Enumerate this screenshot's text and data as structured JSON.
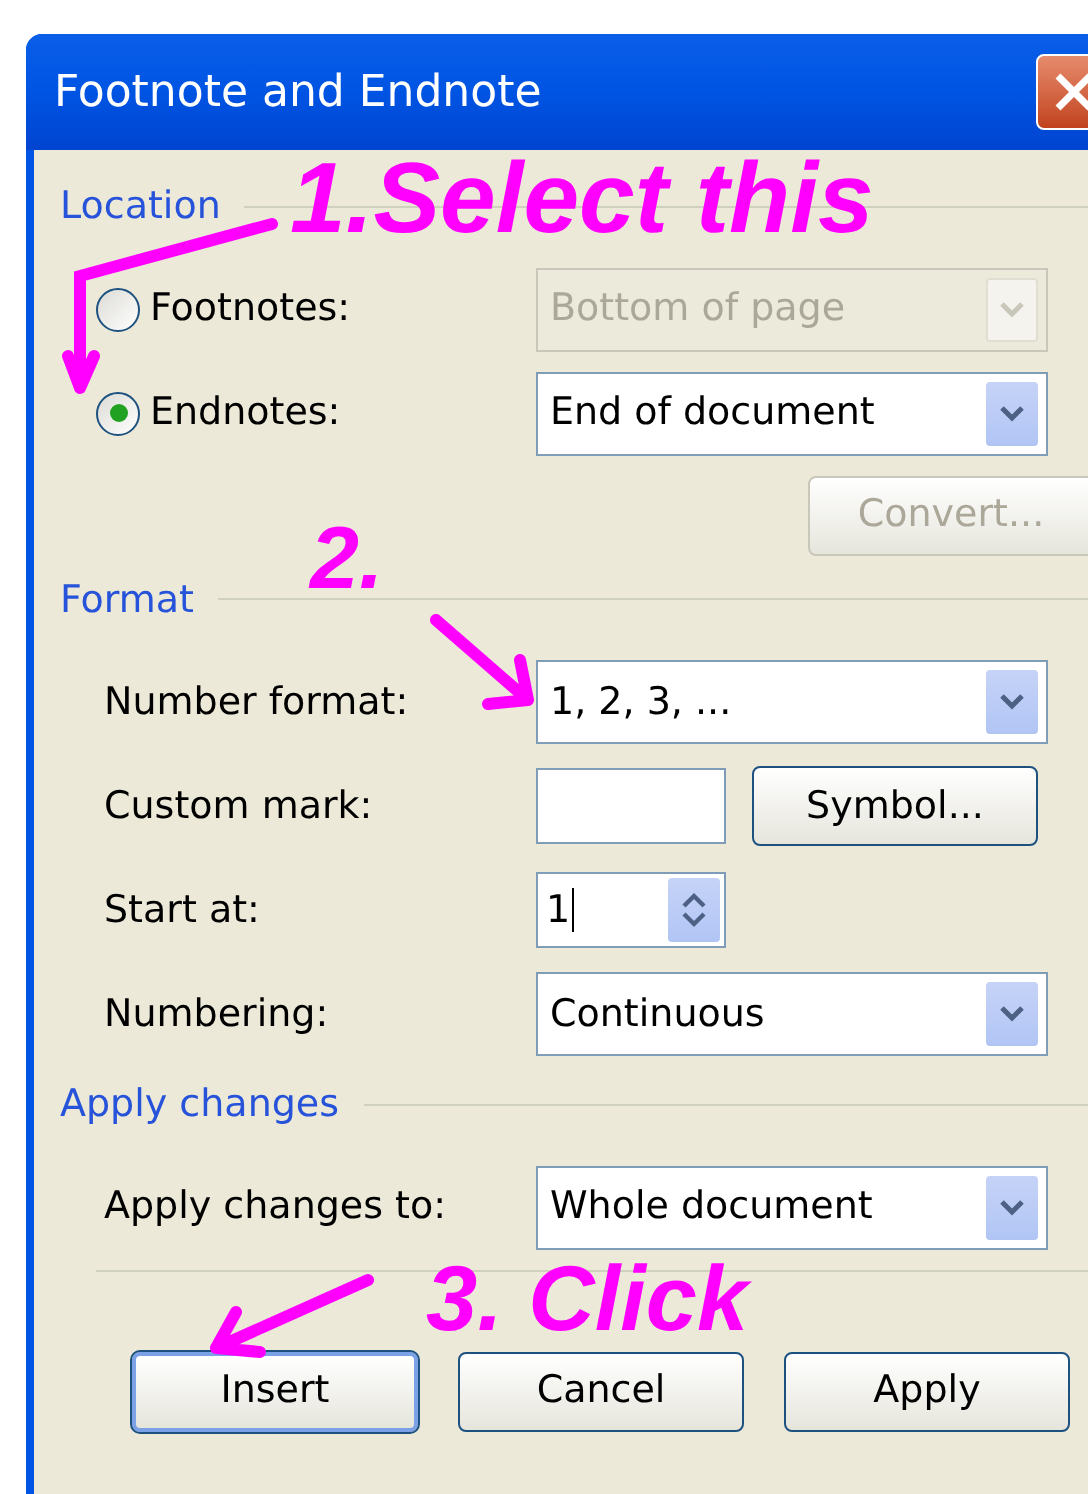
{
  "window": {
    "title": "Footnote and Endnote"
  },
  "sections": [
    {
      "heading": "Location",
      "rows": [
        {
          "kind": "radio",
          "label": "Footnotes:",
          "selected": false,
          "control": {
            "kind": "dropdown",
            "value": "Bottom of page",
            "disabled": true
          }
        },
        {
          "kind": "radio",
          "label": "Endnotes:",
          "selected": true,
          "control": {
            "kind": "dropdown",
            "value": "End of document",
            "disabled": false
          }
        },
        {
          "kind": "button",
          "button": {
            "label": "Convert...",
            "disabled": true
          }
        }
      ]
    },
    {
      "heading": "Format",
      "rows": [
        {
          "kind": "field",
          "label": "Number format:",
          "control": {
            "kind": "dropdown",
            "value": "1, 2, 3, ...",
            "disabled": false
          }
        },
        {
          "kind": "field",
          "label": "Custom mark:",
          "control": {
            "kind": "text_with_button",
            "button": {
              "label": "Symbol..."
            }
          }
        },
        {
          "kind": "field",
          "label": "Start at:",
          "control": {
            "kind": "spinner",
            "value": "1"
          }
        },
        {
          "kind": "field",
          "label": "Numbering:",
          "control": {
            "kind": "dropdown",
            "value": "Continuous",
            "disabled": false
          }
        }
      ]
    },
    {
      "heading": "Apply changes",
      "rows": [
        {
          "kind": "field",
          "label": "Apply changes to:",
          "control": {
            "kind": "dropdown",
            "value": "Whole document",
            "disabled": false
          }
        }
      ]
    }
  ],
  "buttons": [
    {
      "label": "Insert",
      "default": true
    },
    {
      "label": "Cancel",
      "default": false
    },
    {
      "label": "Apply",
      "default": false
    }
  ],
  "annotations": [
    {
      "text": "1.Select this"
    },
    {
      "text": "2."
    },
    {
      "text": "3. Click"
    }
  ]
}
